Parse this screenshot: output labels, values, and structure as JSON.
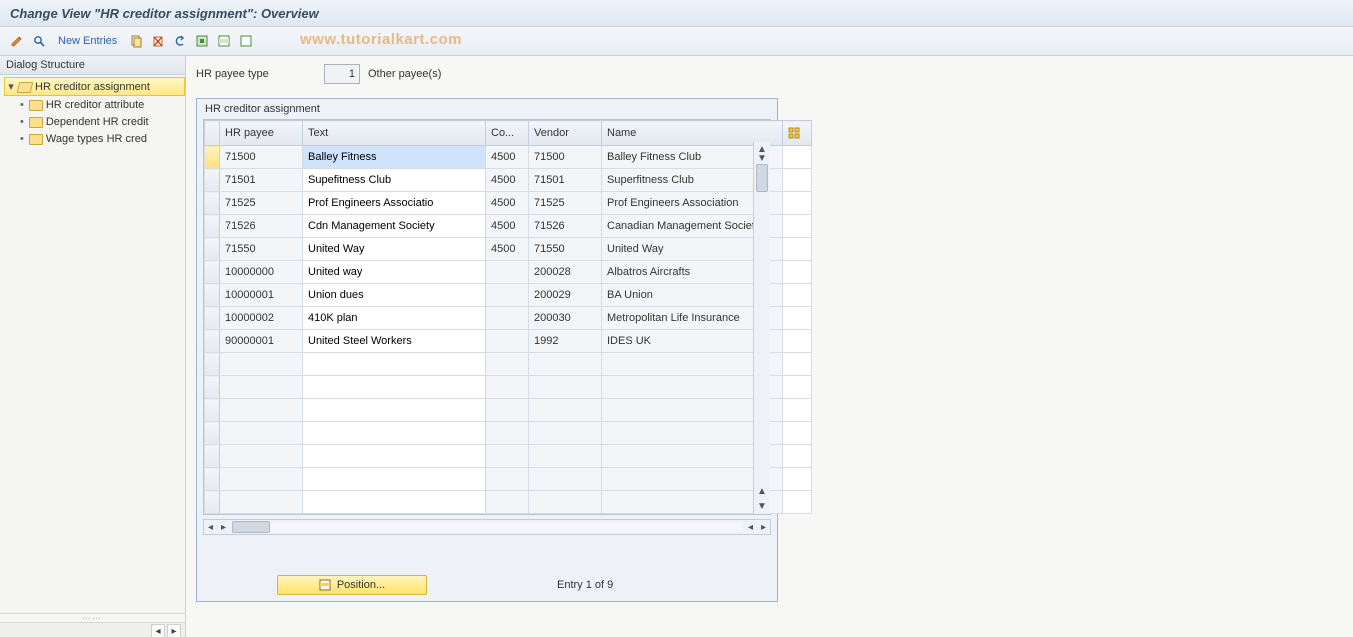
{
  "title": "Change View \"HR creditor assignment\": Overview",
  "toolbar": {
    "new_entries": "New Entries"
  },
  "watermark": "www.tutorialkart.com",
  "sidebar": {
    "header": "Dialog Structure",
    "root": {
      "label": "HR creditor assignment",
      "children": [
        {
          "label": "HR creditor attribute"
        },
        {
          "label": "Dependent HR credit"
        },
        {
          "label": "Wage types HR cred"
        }
      ]
    }
  },
  "payee_type": {
    "label": "HR payee type",
    "value": "1",
    "text": "Other payee(s)"
  },
  "table": {
    "caption": "HR creditor assignment",
    "columns": {
      "hr_payee": "HR payee",
      "text": "Text",
      "co": "Co...",
      "vendor": "Vendor",
      "name": "Name"
    },
    "rows": [
      {
        "hr_payee": "71500",
        "text": "Balley Fitness",
        "co": "4500",
        "vendor": "71500",
        "name": "Balley Fitness Club",
        "active": true
      },
      {
        "hr_payee": "71501",
        "text": "Supefitness Club",
        "co": "4500",
        "vendor": "71501",
        "name": "Superfitness Club"
      },
      {
        "hr_payee": "71525",
        "text": "Prof Engineers Associatio",
        "co": "4500",
        "vendor": "71525",
        "name": "Prof  Engineers Association"
      },
      {
        "hr_payee": "71526",
        "text": "Cdn Management Society",
        "co": "4500",
        "vendor": "71526",
        "name": "Canadian Management Society"
      },
      {
        "hr_payee": "71550",
        "text": "United Way",
        "co": "4500",
        "vendor": "71550",
        "name": "United Way"
      },
      {
        "hr_payee": "10000000",
        "text": "United way",
        "co": "",
        "vendor": "200028",
        "name": "Albatros Aircrafts"
      },
      {
        "hr_payee": "10000001",
        "text": "Union dues",
        "co": "",
        "vendor": "200029",
        "name": "BA Union"
      },
      {
        "hr_payee": "10000002",
        "text": "410K plan",
        "co": "",
        "vendor": "200030",
        "name": "Metropolitan Life Insurance"
      },
      {
        "hr_payee": "90000001",
        "text": "United Steel Workers",
        "co": "",
        "vendor": "1992",
        "name": "IDES UK"
      }
    ],
    "empty_rows": 7
  },
  "footer": {
    "position_button": "Position...",
    "entry_counter": "Entry 1 of 9"
  }
}
